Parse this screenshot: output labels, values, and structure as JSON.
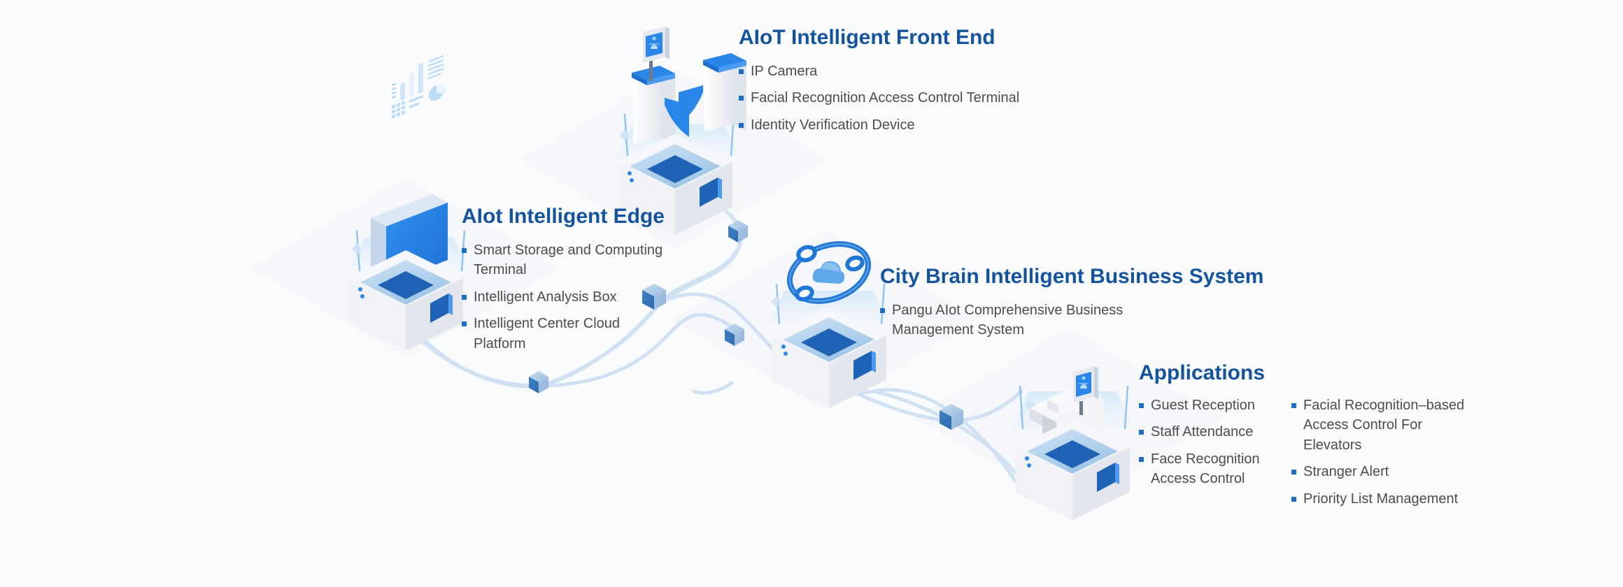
{
  "diagram": {
    "background_color": "#fafbfd",
    "title_color": "#14549e",
    "bullet_color": "#1b6ec2",
    "body_text_color": "#4c4c4c",
    "connector_color": "#c8dcf0",
    "accent_blue": "#1b7ae8",
    "deep_blue": "#1a5fa8"
  },
  "sections": {
    "front_end": {
      "title": "AIoT Intelligent Front End",
      "bullets": [
        "IP Camera",
        "Facial Recognition Access Control Terminal",
        "Identity Verification Device"
      ]
    },
    "edge": {
      "title": "AIot Intelligent Edge",
      "bullets": [
        "Smart Storage and Computing Terminal",
        "Intelligent Analysis Box",
        "Intelligent Center Cloud Platform"
      ]
    },
    "city_brain": {
      "title": "City Brain Intelligent Business System",
      "bullets": [
        "Pangu AIot Comprehensive Business Management System"
      ]
    },
    "applications": {
      "title": "Applications",
      "column_left": [
        "Guest Reception",
        "Staff Attendance",
        "Face Recognition Access Control"
      ],
      "column_right": [
        "Facial Recognition–based Access Control For Elevators",
        "Stranger Alert",
        "Priority List Management"
      ]
    }
  },
  "illustrations": {
    "front_end_icon": "turnstile-gate-with-face-terminal",
    "edge_icon": "analytics-dashboard-panel",
    "city_brain_icon": "cloud-orbit-ring",
    "applications_icon": "reception-desk-with-tablet",
    "pedestal": "isometric-cube-pedestal"
  },
  "connectors": {
    "node_count": 6,
    "node_icon": "isometric-cube-node",
    "path_style": "curved-ribbon"
  }
}
